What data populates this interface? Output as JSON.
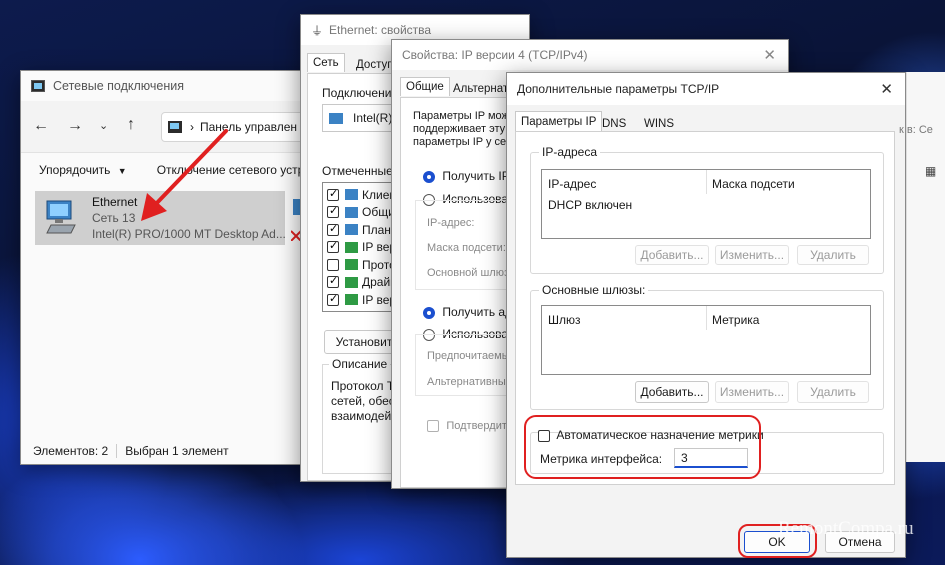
{
  "net_window": {
    "title": "Сетевые подключения",
    "breadcrumb": "Панель управлен",
    "search_fragment": "к в: Се",
    "toolbar": {
      "organize": "Упорядочить",
      "disable": "Отключение сетевого устр"
    },
    "item": {
      "name": "Ethernet",
      "network": "Сеть 13",
      "adapter": "Intel(R) PRO/1000 MT Desktop Ad..."
    },
    "status": {
      "count": "Элементов: 2",
      "selected": "Выбран 1 элемент"
    }
  },
  "eth_props": {
    "title": "Ethernet: свойства",
    "tabs": [
      "Сеть",
      "Доступ"
    ],
    "connect_label": "Подключение",
    "adapter": "Intel(R) F",
    "components_label": "Отмеченные к",
    "components": [
      {
        "label": "Клиен",
        "checked": true
      },
      {
        "label": "Общи",
        "checked": true
      },
      {
        "label": "Плани",
        "checked": true
      },
      {
        "label": "IP вер",
        "checked": true
      },
      {
        "label": "Прото",
        "checked": false
      },
      {
        "label": "Драйв",
        "checked": true
      },
      {
        "label": "IP вер",
        "checked": true
      }
    ],
    "install_button": "Установит",
    "desc_label": "Описание",
    "desc_lines": [
      "Протокол Т",
      "сетей, обес",
      "взаимодей"
    ]
  },
  "ipv4": {
    "title": "Свойства: IP версии 4 (TCP/IPv4)",
    "tabs": [
      "Общие",
      "Альтернат"
    ],
    "intro_lines": [
      "Параметры IP мож",
      "поддерживает эту",
      "параметры IP у се"
    ],
    "auto_ip": "Получить IP-",
    "manual_ip": "Использовать",
    "ip_label": "IP-адрес:",
    "mask_label": "Маска подсети:",
    "gateway_label": "Основной шлюз",
    "auto_dns": "Получить адр",
    "manual_dns": "Использовать",
    "pref_dns": "Предпочитаемы",
    "alt_dns": "Альтернативны",
    "confirm": "Подтвердит"
  },
  "adv": {
    "title": "Дополнительные параметры TCP/IP",
    "tabs": [
      "Параметры IP",
      "DNS",
      "WINS"
    ],
    "ip_group": {
      "legend": "IP-адреса",
      "col1": "IP-адрес",
      "col2": "Маска подсети",
      "row": "DHCP включен",
      "add": "Добавить...",
      "edit": "Изменить...",
      "delete": "Удалить"
    },
    "gw_group": {
      "legend": "Основные шлюзы:",
      "col1": "Шлюз",
      "col2": "Метрика",
      "add": "Добавить...",
      "edit": "Изменить...",
      "delete": "Удалить"
    },
    "auto_metric": "Автоматическое назначение метрики",
    "metric_label": "Метрика интерфейса:",
    "metric_value": "3",
    "ok": "OK",
    "cancel": "Отмена"
  },
  "watermark": "RemontCompa.ru"
}
